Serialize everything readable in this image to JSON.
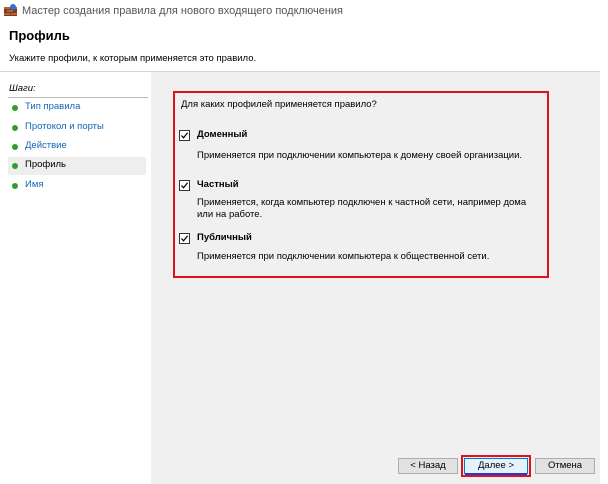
{
  "window": {
    "title": "Мастер создания правила для нового входящего подключения"
  },
  "header": {
    "title": "Профиль",
    "subtitle": "Укажите профили, к которым применяется это правило."
  },
  "sidebar": {
    "label": "Шаги:",
    "items": [
      {
        "label": "Тип правила"
      },
      {
        "label": "Протокол и порты"
      },
      {
        "label": "Действие"
      },
      {
        "label": "Профиль"
      },
      {
        "label": "Имя"
      }
    ],
    "selected_index": 3
  },
  "main": {
    "question": "Для каких профилей применяется правило?",
    "profiles": [
      {
        "label": "Доменный",
        "checked": true,
        "description": "Применяется при подключении компьютера к домену своей организации."
      },
      {
        "label": "Частный",
        "checked": true,
        "description": "Применяется, когда компьютер подключен к частной сети, например дома или на работе."
      },
      {
        "label": "Публичный",
        "checked": true,
        "description": "Применяется при подключении компьютера к общественной сети."
      }
    ]
  },
  "buttons": {
    "back": "< Назад",
    "next": "Далее >",
    "cancel": "Отмена"
  },
  "colors": {
    "highlight": "#e0101e",
    "link": "#1366b6",
    "bullet": "#2f9e2f"
  },
  "icons": {
    "app": "firewall-wall-icon",
    "check": "checkmark-icon",
    "step_bullet": "green-dot-icon"
  }
}
